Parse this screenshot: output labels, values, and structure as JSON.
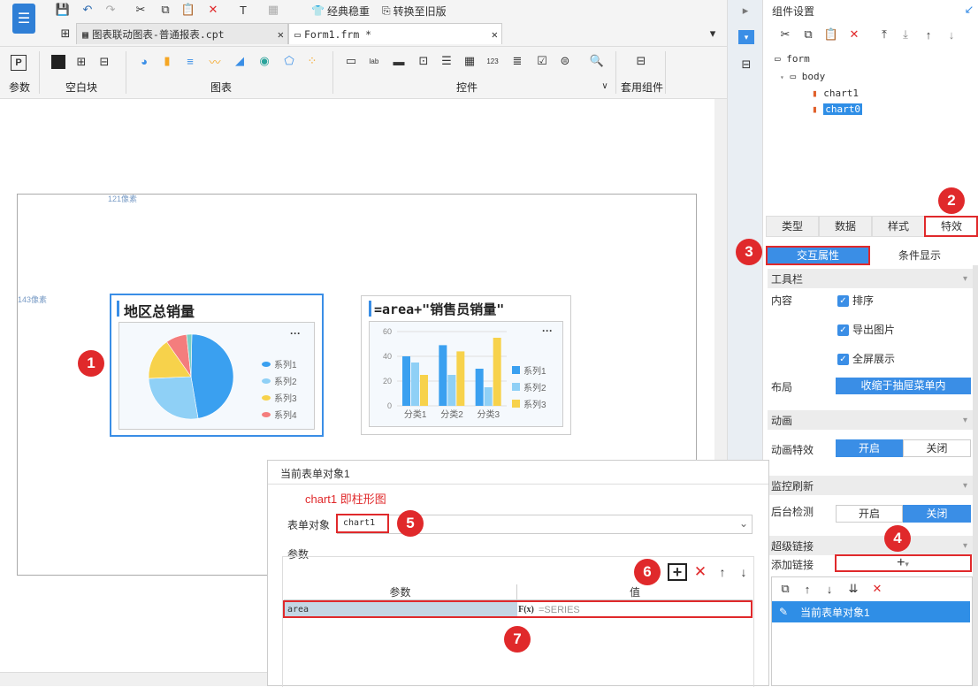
{
  "toolbar": {
    "classic_btn": "经典稳重",
    "convert_btn": "转换至旧版",
    "tab1": "图表联动图表-普通报表.cpt",
    "tab2": "Form1.frm *",
    "groups": {
      "param": "参数",
      "blank": "空白块",
      "chart": "图表",
      "widget": "控件",
      "suite": "套用组件"
    }
  },
  "canvas": {
    "ruler_w": "121像素",
    "ruler_h": "143像素",
    "chart0": {
      "title": "地区总销量",
      "legend": [
        "系列1",
        "系列2",
        "系列3",
        "系列4"
      ],
      "menu": "···"
    },
    "chart1": {
      "title": "=area+\"销售员销量\"",
      "legend": [
        "系列1",
        "系列2",
        "系列3"
      ],
      "menu": "···",
      "yticks": [
        "60",
        "40",
        "20",
        "0"
      ],
      "categories": [
        "分类1",
        "分类2",
        "分类3"
      ]
    }
  },
  "chart_data": [
    {
      "type": "pie",
      "values": [
        47,
        27,
        16,
        8,
        2
      ],
      "legend": [
        "系列1",
        "系列2",
        "系列3",
        "系列4"
      ],
      "title": "地区总销量",
      "colors": [
        "#3aa0f0",
        "#8fd0f6",
        "#f7d24b",
        "#f47d7d",
        "#7ad0c6"
      ]
    },
    {
      "type": "bar",
      "categories": [
        "分类1",
        "分类2",
        "分类3"
      ],
      "series": [
        {
          "name": "系列1",
          "values": [
            40,
            49,
            30
          ]
        },
        {
          "name": "系列2",
          "values": [
            35,
            25,
            15
          ]
        },
        {
          "name": "系列3",
          "values": [
            25,
            44,
            55
          ]
        }
      ],
      "ylim": [
        0,
        60
      ],
      "title": "=area+\"销售员销量\"",
      "colors": [
        "#3aa0f0",
        "#8fd0f6",
        "#f7d24b"
      ]
    }
  ],
  "right": {
    "header": "组件设置",
    "tree": {
      "form": "form",
      "body": "body",
      "chart1": "chart1",
      "chart0": "chart0"
    },
    "tabs": [
      "类型",
      "数据",
      "样式",
      "特效"
    ],
    "subtabs": [
      "交互属性",
      "条件显示"
    ],
    "toolbar_sec": "工具栏",
    "content_label": "内容",
    "checks": [
      "排序",
      "导出图片",
      "全屏展示"
    ],
    "layout_label": "布局",
    "layout_value": "收缩于抽屉菜单内",
    "anim_sec": "动画",
    "anim_label": "动画特效",
    "anim_on": "开启",
    "anim_off": "关闭",
    "monitor_sec": "监控刷新",
    "bg_label": "后台检测",
    "bg_on": "开启",
    "bg_off": "关闭",
    "link_sec": "超级链接",
    "add_link": "添加链接",
    "link_item": "当前表单对象1"
  },
  "dialog": {
    "title": "当前表单对象1",
    "note": "chart1 即柱形图",
    "obj_label": "表单对象",
    "obj_value": "chart1",
    "params_label": "参数",
    "col_param": "参数",
    "col_value": "值",
    "row_param": "area",
    "row_value": "=SERIES",
    "fx": "F(x)"
  },
  "badges": [
    "1",
    "2",
    "3",
    "4",
    "5",
    "6",
    "7"
  ],
  "colors": {
    "accent": "#3a8ee6",
    "red": "#e0292b",
    "selected": "#2f8ee6"
  }
}
